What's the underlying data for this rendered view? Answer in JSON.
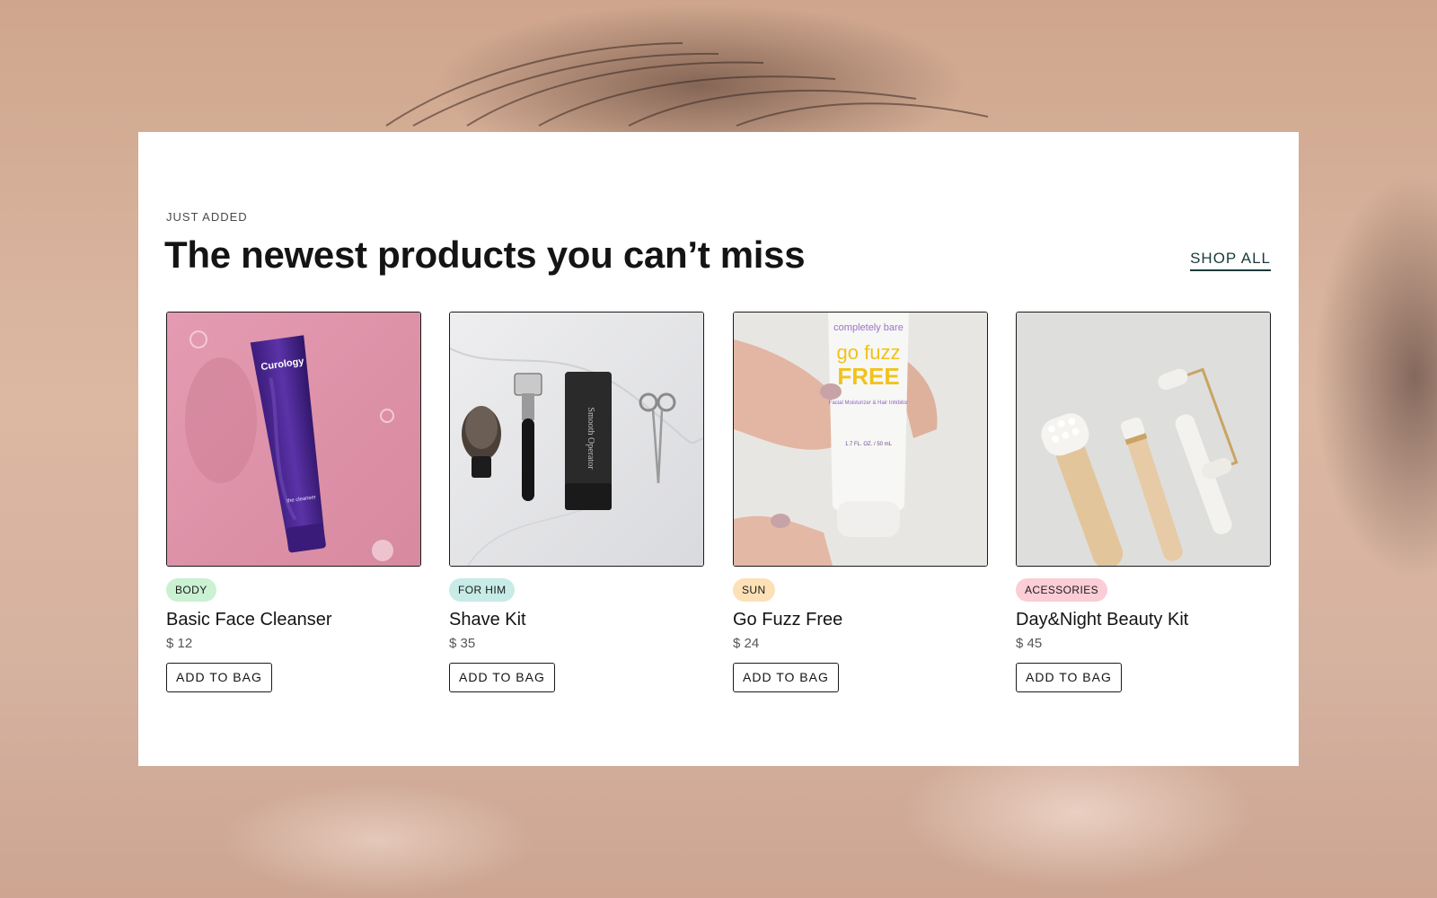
{
  "section": {
    "eyebrow": "JUST ADDED",
    "headline": "The newest products you can’t miss",
    "shop_all_label": "SHOP ALL"
  },
  "products": [
    {
      "tag": "BODY",
      "tag_color": "#c9f1d2",
      "name": "Basic Face Cleanser",
      "price": "$ 12",
      "button": "ADD TO BAG",
      "image": "purple-cleanser-tube-on-pink-water"
    },
    {
      "tag": "FOR HIM",
      "tag_color": "#c7ebe6",
      "name": "Shave Kit",
      "price": "$ 35",
      "button": "ADD TO BAG",
      "image": "shaving-brush-razor-tube-scissors-on-marble"
    },
    {
      "tag": "SUN",
      "tag_color": "#fde0b6",
      "name": "Go Fuzz Free",
      "price": "$ 24",
      "button": "ADD TO BAG",
      "image": "hand-holding-lotion-tube"
    },
    {
      "tag": "ACESSORIES",
      "tag_color": "#fbcdd6",
      "name": "Day&Night Beauty Kit",
      "price": "$ 45",
      "button": "ADD TO BAG",
      "image": "facial-brush-and-jade-rollers"
    }
  ],
  "image_text": {
    "cleanser_brand": "Curology",
    "cleanser_sub": "the cleanser",
    "shave_tube": "Smooth Operator",
    "lotion_brand": "completely bare",
    "lotion_title_1": "go fuzz",
    "lotion_title_2": "FREE",
    "lotion_sub": "Facial Moisturizer & Hair Inhibitor",
    "lotion_vol": "1.7 FL. OZ. / 50 mL"
  }
}
